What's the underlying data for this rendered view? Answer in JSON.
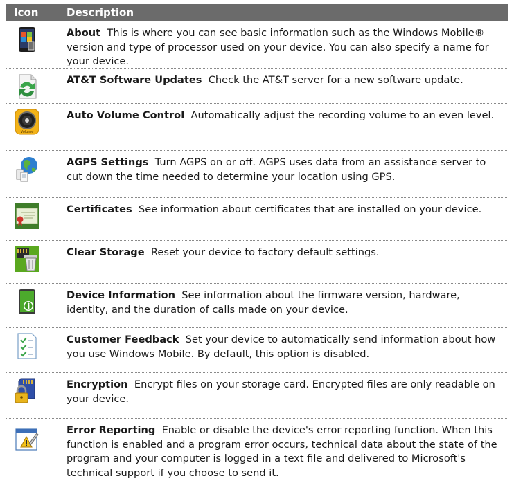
{
  "header": {
    "col_icon": "Icon",
    "col_description": "Description"
  },
  "rows": [
    {
      "icon": "about-icon",
      "title": "About",
      "text": "This is where you can see basic information such as the Windows Mobile® version and type of processor used on your device. You can also specify a name for your device."
    },
    {
      "icon": "software-update-icon",
      "title": "AT&T Software Updates",
      "text": "Check the AT&T server for a new software update."
    },
    {
      "icon": "auto-volume-icon",
      "title": "Auto Volume Control",
      "text": "Automatically adjust the recording volume to an even level.",
      "icon_caption": "Volume"
    },
    {
      "icon": "agps-icon",
      "title": "AGPS Settings",
      "text": "Turn AGPS on or off. AGPS uses data from an assistance server to cut down the time needed to determine your location using GPS."
    },
    {
      "icon": "certificates-icon",
      "title": "Certificates",
      "text": "See information about certificates that are installed on your device."
    },
    {
      "icon": "clear-storage-icon",
      "title": "Clear Storage",
      "text": "Reset your device to factory default settings."
    },
    {
      "icon": "device-information-icon",
      "title": "Device Information",
      "text": "See information about the firmware version, hardware, identity, and the duration of calls made on your device."
    },
    {
      "icon": "customer-feedback-icon",
      "title": "Customer Feedback",
      "text": "Set your device to automatically send information about how you use Windows Mobile. By default, this option is disabled."
    },
    {
      "icon": "encryption-icon",
      "title": "Encryption",
      "text": "Encrypt files on your storage card. Encrypted files are only readable on your device."
    },
    {
      "icon": "error-reporting-icon",
      "title": "Error Reporting",
      "text": "Enable or disable the device's error reporting function. When this function is enabled and a program error occurs, technical data about the state of the program and your computer is logged in a text file and delivered to Microsoft's technical support if you choose to send it."
    }
  ]
}
